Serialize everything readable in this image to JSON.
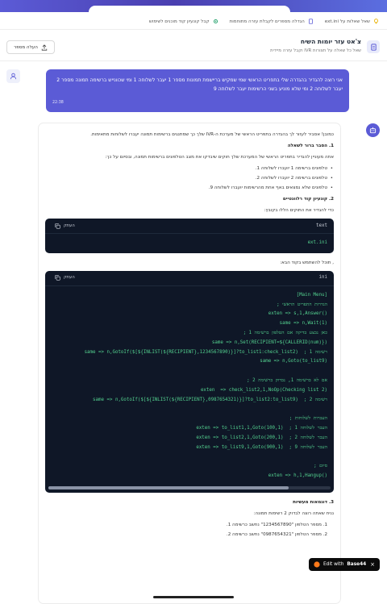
{
  "quicklinks": [
    {
      "label": "שאל שאלות על ext.ini",
      "icon": "lightbulb-icon",
      "color": "#e8b100"
    },
    {
      "label": "הגדלה מספרים לקבלת עזרה מתוחמות",
      "icon": "document-icon",
      "color": "#5b5bd6"
    },
    {
      "label": "קבל קונעיון קוד מוכנים לשימוש",
      "icon": "settings-icon",
      "color": "#22a06b"
    }
  ],
  "header": {
    "title": "צ'אט עזר יומות השיח",
    "subtitle": "שאל כל שאלה על תצורות IVR וקבל עזרה מיידית",
    "share_label": "העלה מספר"
  },
  "user_message": {
    "text": "אני רוצה להגדיר בהגדרה שלי בתפריט הראשי שמי שמקיש בריישמת תמונות מספר 1 יעבר לשלוחה 1 ומי שכוונייש ברשימה תמונה מספר 2 יעבר לשלוחה 2 ומי שלא מוניע בשני הרשימות יעבר לשלוחה 9",
    "time": "22:38"
  },
  "bot_message": {
    "intro": "כמובן! אסביר לעזור לך בהגדרה בתפריט הראשי של מערכת ה-IVR שלך כך שמתנגים ברשימות תמונה יעברו לשלוחות מתאימות.",
    "s1_title": "1. הסבר ברור לשאלה",
    "s1_text": "אתה מעוניין להגדיר בתפריט הראשי של המערכת שלך חוקים שיבדקו את מצב הטלפונים ברשימות תמונה, ובסיום על כך:",
    "s1_bullets": [
      "טלפונים ברשימה 1 יועברו לשלוחה 1.",
      "טלפונים ברשימה 2 יועברו לשלוחה 2.",
      "טלפונים שלא נמצאים באף אחת מהרשימות יועברו לשלוחה 9."
    ],
    "s2_title": "2. קונעיון קוד רלוונטיים",
    "s2_text": "כדי להגדיר את התוקים הללו בקובץ:",
    "code1": {
      "lang": "text",
      "copy_label": "העתק",
      "content": "ext.ini"
    },
    "s2_text2": ", תוכל להשתמש בקוד הבא:",
    "code2": {
      "lang": "ini",
      "copy_label": "העתק",
      "content": "[Main Menu]\n; הגדרות התפריט הראשי\nexten => s,1,Answer()\nsame => n,Wait(1)\n; כאן נבצע בדיקה אם הטלפון ברשימה 1\nsame => n,Set(RECIPIENT=${CALLERID(num)})\nsame => n,GotoIf($[${INLIST(${RECIPIENT},1234567890)}]?to_list1:check_list2)  ; רשימה 1\nsame => n,Goto(to_list9)\n\n; אם לא ברשימה 1, נבדוק ברשימה 2\nexten  => check_list2,1,NoOp(Checking list 2)\nsame => n,GotoIf($[${INLIST(${RECIPIENT},0987654321)}]?to_list2:to_list9)  ; רשימה 2\n\n; העברות לשלוחות\nexten => to_list1,1,Goto(100,1)  ; העבר לשלוחה 1\nexten => to_list2,1,Goto(200,1)  ; העבר לשלוחה 2\nexten => to_list9,1,Goto(900,1)  ; העבר לשלוחה 9\n\n; סיום\nexten => h,1,Hangup()"
    },
    "s3_title": "3. דוגמאות מעשיות",
    "s3_text": "נניח שאתה רוצה לבדוק 2 רשימות תמונה:",
    "s3_items": [
      "1. מספר הטלפון \"1234567890\" נחשב כרשימה 1.",
      "2. מספר הטלפון \"0987654321\" נחשב כרשימה 2."
    ]
  },
  "edit_badge": {
    "label": "Edit with",
    "brand": "Base44"
  }
}
